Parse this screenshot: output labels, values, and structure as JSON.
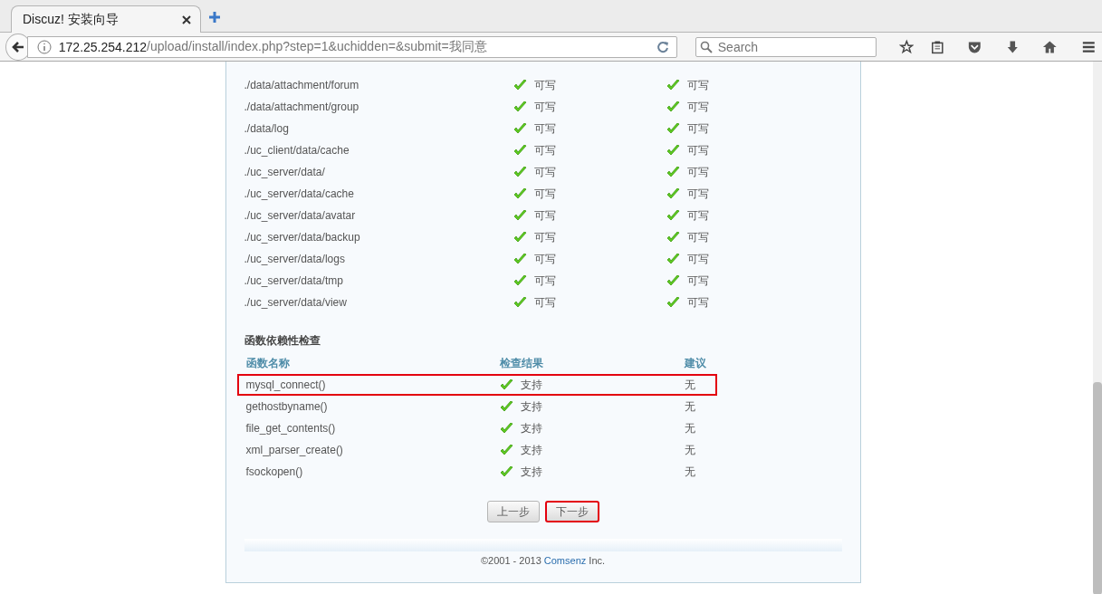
{
  "browser": {
    "tab_title": "Discuz! 安装向导",
    "url_host": "172.25.254.212",
    "url_path": "/upload/install/index.php?step=1&uchidden=&submit=我同意",
    "search_placeholder": "Search"
  },
  "dir_rows": [
    {
      "path": "./data/attachment/forum",
      "current": "可写",
      "required": "可写"
    },
    {
      "path": "./data/attachment/group",
      "current": "可写",
      "required": "可写"
    },
    {
      "path": "./data/log",
      "current": "可写",
      "required": "可写"
    },
    {
      "path": "./uc_client/data/cache",
      "current": "可写",
      "required": "可写"
    },
    {
      "path": "./uc_server/data/",
      "current": "可写",
      "required": "可写"
    },
    {
      "path": "./uc_server/data/cache",
      "current": "可写",
      "required": "可写"
    },
    {
      "path": "./uc_server/data/avatar",
      "current": "可写",
      "required": "可写"
    },
    {
      "path": "./uc_server/data/backup",
      "current": "可写",
      "required": "可写"
    },
    {
      "path": "./uc_server/data/logs",
      "current": "可写",
      "required": "可写"
    },
    {
      "path": "./uc_server/data/tmp",
      "current": "可写",
      "required": "可写"
    },
    {
      "path": "./uc_server/data/view",
      "current": "可写",
      "required": "可写"
    }
  ],
  "func_section": {
    "title": "函数依赖性检查",
    "columns": [
      "函数名称",
      "检查结果",
      "建议"
    ],
    "rows": [
      {
        "name": "mysql_connect()",
        "result": "支持",
        "advice": "无",
        "highlighted": true
      },
      {
        "name": "gethostbyname()",
        "result": "支持",
        "advice": "无",
        "highlighted": false
      },
      {
        "name": "file_get_contents()",
        "result": "支持",
        "advice": "无",
        "highlighted": false
      },
      {
        "name": "xml_parser_create()",
        "result": "支持",
        "advice": "无",
        "highlighted": false
      },
      {
        "name": "fsockopen()",
        "result": "支持",
        "advice": "无",
        "highlighted": false
      }
    ]
  },
  "buttons": [
    {
      "label": "上一步",
      "highlighted": false
    },
    {
      "label": "下一步",
      "highlighted": true
    }
  ],
  "footer": {
    "prefix": "©2001 - 2013 ",
    "link": "Comsenz",
    "suffix": " Inc."
  }
}
